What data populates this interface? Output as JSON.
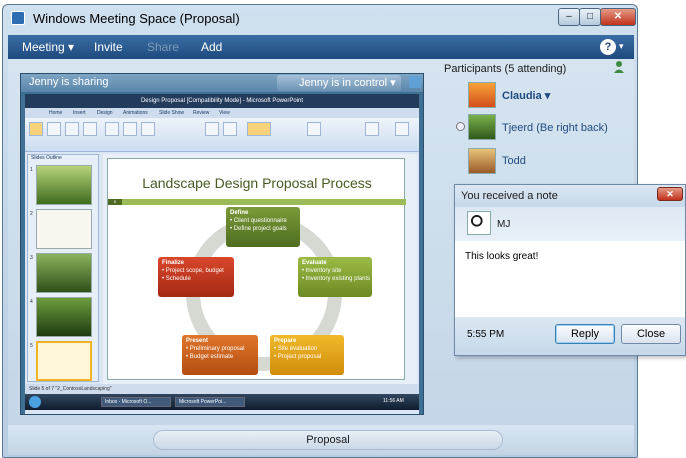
{
  "window": {
    "title": "Windows Meeting Space (Proposal)",
    "minimize": "–",
    "maximize": "□",
    "close": "✕"
  },
  "menu": {
    "meeting": "Meeting ▾",
    "invite": "Invite",
    "share": "Share",
    "add": "Add",
    "help": "?",
    "help_caret": "▾"
  },
  "share": {
    "sharing_label": "Jenny is sharing",
    "control_label": "Jenny is in control ▾",
    "app": {
      "title": "Design Proposal [Compatibility Mode] - Microsoft PowerPoint",
      "tabs": [
        "Home",
        "Insert",
        "Design",
        "Animations",
        "Slide Show",
        "Review",
        "View"
      ],
      "left_tabs": "Slides  Outline",
      "thumb_numbers": [
        "1",
        "2",
        "3",
        "4",
        "5"
      ],
      "slide": {
        "title": "Landscape Design Proposal Process",
        "number": "5",
        "steps": {
          "define": {
            "title": "Define",
            "items": "• Client questionnaire\n• Define project goals"
          },
          "evaluate": {
            "title": "Evaluate",
            "items": "• Inventory site\n• Inventory existing plants"
          },
          "prepare": {
            "title": "Prepare",
            "items": "• Site evaluation\n• Project proposal"
          },
          "present": {
            "title": "Present",
            "items": "• Preliminary proposal\n• Budget estimate"
          },
          "finalize": {
            "title": "Finalize",
            "items": "• Project scope, budget\n• Schedule"
          }
        }
      },
      "status": "Slide 5 of 7   \"2_ContosoLandscaping\"",
      "taskbar": [
        "Inbox - Microsoft O...",
        "Microsoft PowerPoi..."
      ],
      "clock": "11:56 AM"
    }
  },
  "participants": {
    "title": "Participants (5 attending)",
    "list": [
      {
        "name": "Claudia ▾"
      },
      {
        "name": "Tjeerd  (Be right back)"
      },
      {
        "name": "Todd"
      }
    ]
  },
  "note": {
    "title": "You received a note",
    "close_icon": "✕",
    "from": "MJ",
    "message": "This looks great!",
    "time": "5:55 PM",
    "reply": "Reply",
    "close": "Close"
  },
  "footer": {
    "meeting_name": "Proposal"
  }
}
